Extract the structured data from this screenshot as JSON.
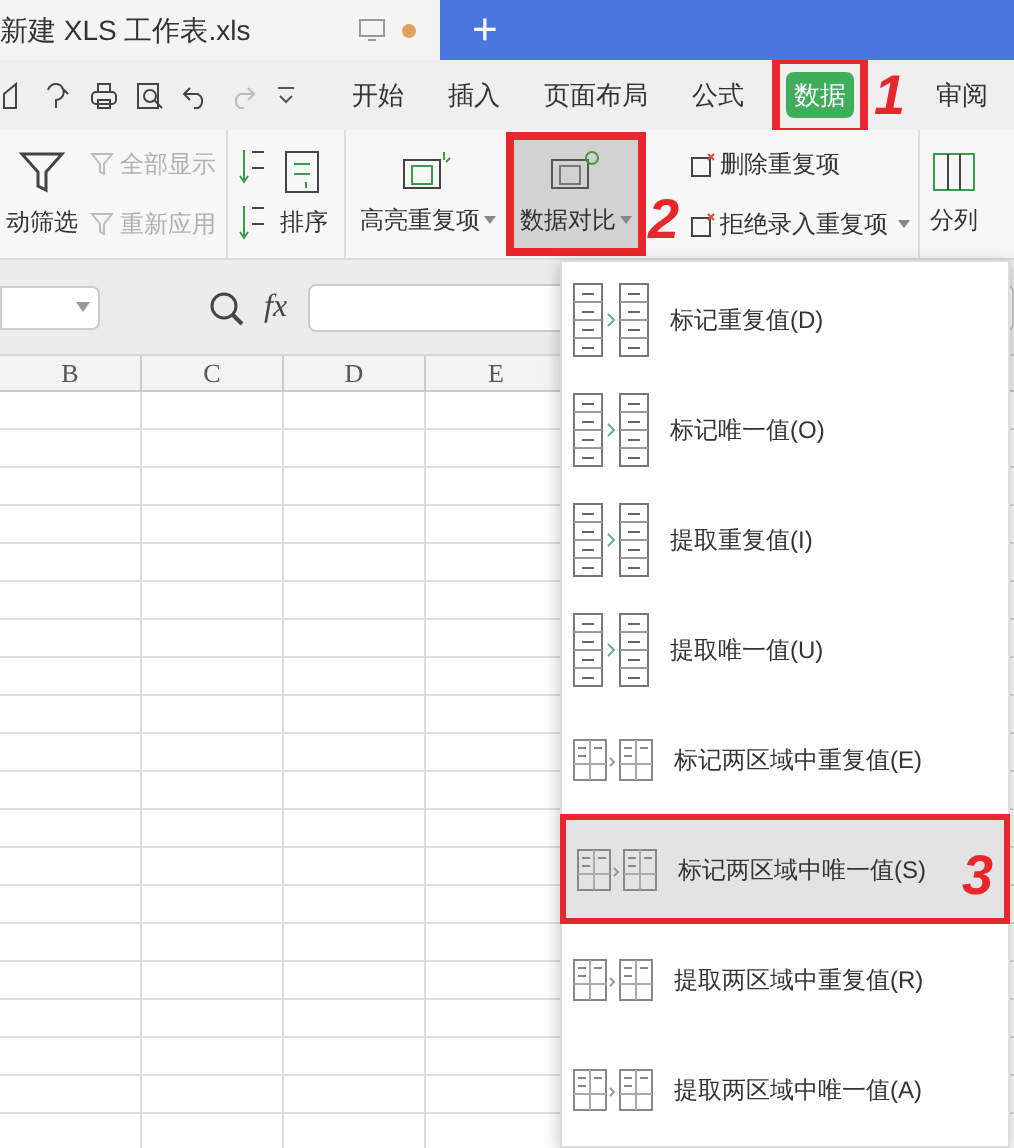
{
  "title_bar": {
    "document_tab": "新建 XLS 工作表.xls",
    "new_tab_button": "+"
  },
  "menu_tabs": [
    {
      "label": "开始",
      "selected": false
    },
    {
      "label": "插入",
      "selected": false
    },
    {
      "label": "页面布局",
      "selected": false
    },
    {
      "label": "公式",
      "selected": false
    },
    {
      "label": "数据",
      "selected": true
    },
    {
      "label": "审阅",
      "selected": false
    }
  ],
  "ribbon": {
    "filter": {
      "label": "动筛选"
    },
    "filter_small": [
      {
        "label": "全部显示",
        "disabled": true
      },
      {
        "label": "重新应用",
        "disabled": true
      }
    ],
    "sort": {
      "label": "排序"
    },
    "highlight": {
      "label": "高亮重复项",
      "selected": false
    },
    "compare": {
      "label": "数据对比",
      "selected": true
    },
    "duplicates_small": [
      {
        "label": "删除重复项",
        "dropdown": false
      },
      {
        "label": "拒绝录入重复项",
        "dropdown": true
      }
    ],
    "split": {
      "label": "分列"
    }
  },
  "formula_bar": {
    "fx": "fx"
  },
  "columns": [
    "B",
    "C",
    "D",
    "E"
  ],
  "dropdown_menu": [
    {
      "label": "标记重复值(D)",
      "kind": "single",
      "selected": false
    },
    {
      "label": "标记唯一值(O)",
      "kind": "single",
      "selected": false
    },
    {
      "label": "提取重复值(I)",
      "kind": "single",
      "selected": false
    },
    {
      "label": "提取唯一值(U)",
      "kind": "single",
      "selected": false
    },
    {
      "label": "标记两区域中重复值(E)",
      "kind": "double",
      "selected": false
    },
    {
      "label": "标记两区域中唯一值(S)",
      "kind": "double",
      "selected": true
    },
    {
      "label": "提取两区域中重复值(R)",
      "kind": "double",
      "selected": false
    },
    {
      "label": "提取两区域中唯一值(A)",
      "kind": "double",
      "selected": false
    }
  ],
  "annotations": [
    "1",
    "2",
    "3"
  ]
}
